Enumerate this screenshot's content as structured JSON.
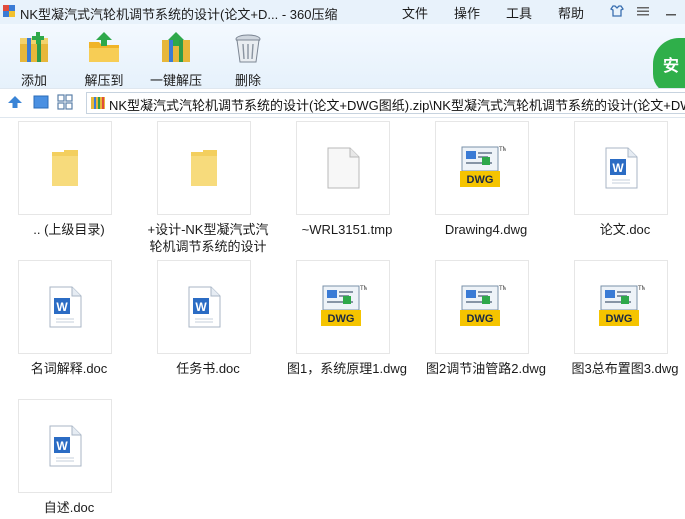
{
  "window": {
    "title": "NK型凝汽式汽轮机调节系统的设计(论文+D... - 360压缩",
    "menu": [
      "文件",
      "操作",
      "工具",
      "帮助"
    ]
  },
  "toolbar": {
    "add": "添加",
    "extract": "解压到",
    "one_click": "一键解压",
    "delete": "删除",
    "safe_badge": "安"
  },
  "path": {
    "text": "NK型凝汽式汽轮机调节系统的设计(论文+DWG图纸).zip\\NK型凝汽式汽轮机调节系统的设计(论文+DWG图纸"
  },
  "files": [
    {
      "name": ".. (上级目录)",
      "icon": "folder-icon"
    },
    {
      "name": "+设计-NK型凝汽式汽轮机调节系统的设计",
      "icon": "folder-icon"
    },
    {
      "name": "~WRL3151.tmp",
      "icon": "blank-file-icon"
    },
    {
      "name": "Drawing4.dwg",
      "icon": "dwg-file-icon"
    },
    {
      "name": "论文.doc",
      "icon": "word-doc-icon"
    },
    {
      "name": "名词解释.doc",
      "icon": "word-doc-icon"
    },
    {
      "name": "任务书.doc",
      "icon": "word-doc-icon"
    },
    {
      "name": "图1，系统原理1.dwg",
      "icon": "dwg-file-icon"
    },
    {
      "name": "图2调节油管路2.dwg",
      "icon": "dwg-file-icon"
    },
    {
      "name": "图3总布置图3.dwg",
      "icon": "dwg-file-icon"
    },
    {
      "name": "自述.doc",
      "icon": "word-doc-icon"
    }
  ],
  "colors": {
    "folder": "#f3cf5e",
    "dwg_label_bg": "#f5c400",
    "word_blue": "#2b6cc4",
    "safe_green": "#2faf4a"
  }
}
